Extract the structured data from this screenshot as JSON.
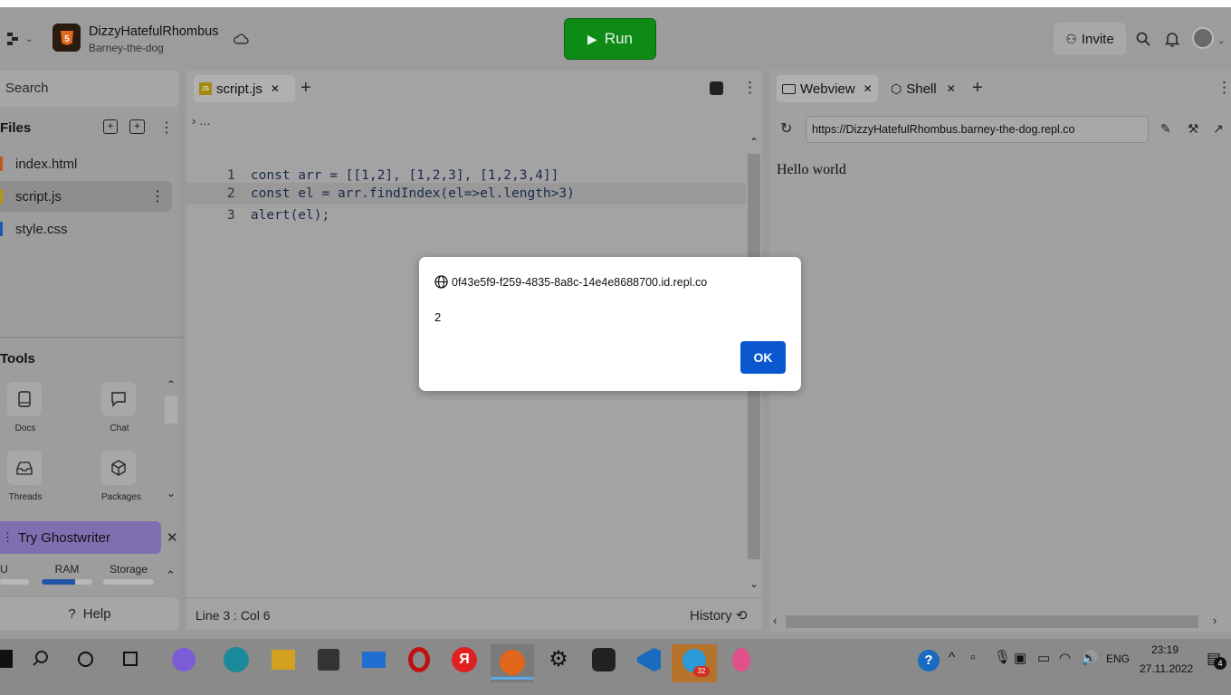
{
  "repl": {
    "name": "DizzyHatefulRhombus",
    "owner": "Barney-the-dog",
    "run_label": "Run",
    "invite_label": "Invite"
  },
  "sidebar": {
    "search_label": "Search",
    "files_title": "Files",
    "files": [
      "index.html",
      "script.js",
      "style.css"
    ],
    "tools_title": "Tools",
    "tools": [
      "Docs",
      "Chat",
      "Threads",
      "Packages"
    ],
    "ghostwriter_label": "Try Ghostwriter",
    "resources": [
      "U",
      "RAM",
      "Storage"
    ],
    "help_label": "Help"
  },
  "editor": {
    "tab_label": "script.js",
    "breadcrumb": "…",
    "lines": [
      {
        "num": "1",
        "text": "const arr = [[1,2], [1,2,3], [1,2,3,4]]"
      },
      {
        "num": "2",
        "text": "const el = arr.findIndex(el=>el.length>3)"
      },
      {
        "num": "3",
        "text": "alert(el);"
      }
    ],
    "status": "Line 3 : Col 6",
    "history_label": "History"
  },
  "webview": {
    "tab_webview": "Webview",
    "tab_shell": "Shell",
    "url": "https://DizzyHatefulRhombus.barney-the-dog.repl.co",
    "content": "Hello world"
  },
  "dialog": {
    "origin": "0f43e5f9-f259-4835-8a8c-14e4e8688700.id.repl.co",
    "message": "2",
    "ok_label": "OK"
  },
  "taskbar": {
    "lang": "ENG",
    "time": "23:19",
    "date": "27.11.2022",
    "telegram_badge": "32",
    "notif_count": "4"
  },
  "colors": {
    "run": "#0e8a16",
    "ok": "#0b57d0",
    "ghostwriter": "#7f6fb0"
  }
}
